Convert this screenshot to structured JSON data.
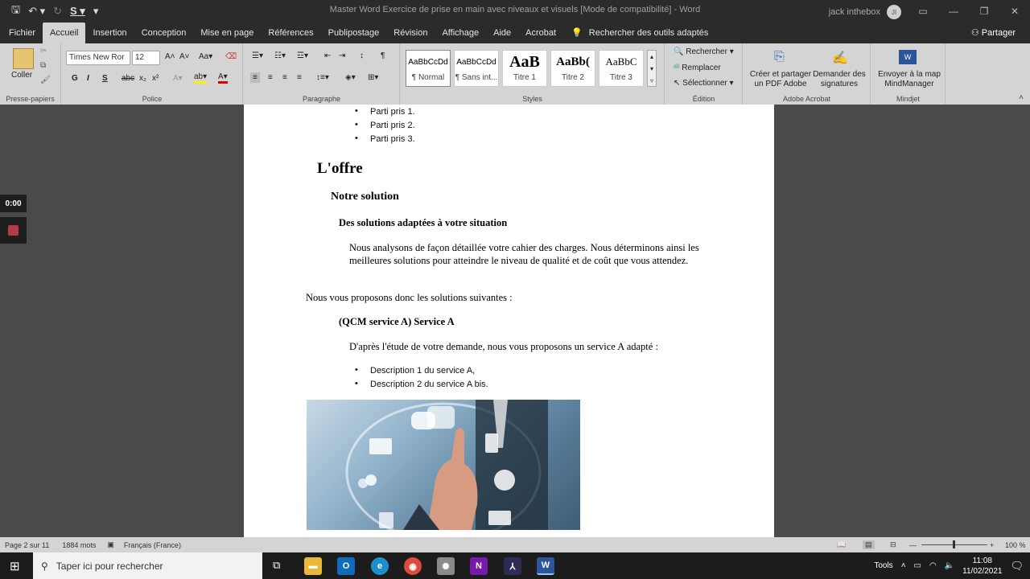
{
  "window": {
    "title": "Master Word Exercice de prise en main avec niveaux et visuels [Mode de compatibilité]  -  Word",
    "user_name": "jack inthebox",
    "user_initials": "JI"
  },
  "tabs": [
    "Fichier",
    "Accueil",
    "Insertion",
    "Conception",
    "Mise en page",
    "Références",
    "Publipostage",
    "Révision",
    "Affichage",
    "Aide",
    "Acrobat"
  ],
  "active_tab": "Accueil",
  "tell_me": "Rechercher des outils adaptés",
  "share_label": "Partager",
  "ribbon": {
    "clipboard": {
      "paste_label": "Coller",
      "group_label": "Presse-papiers"
    },
    "font": {
      "font_name": "Times New Ror",
      "font_size": "12",
      "group_label": "Police",
      "bold": "G",
      "italic": "I",
      "underline": "S"
    },
    "paragraph": {
      "group_label": "Paragraphe"
    },
    "styles": {
      "group_label": "Styles",
      "items": [
        {
          "preview": "AaBbCcDd",
          "name": "¶ Normal"
        },
        {
          "preview": "AaBbCcDd",
          "name": "¶ Sans int..."
        },
        {
          "preview": "AaB",
          "name": "Titre 1"
        },
        {
          "preview": "AaBb(",
          "name": "Titre 2"
        },
        {
          "preview": "AaBbC",
          "name": "Titre 3"
        }
      ]
    },
    "editing": {
      "group_label": "Édition",
      "find": "Rechercher",
      "replace": "Remplacer",
      "select": "Sélectionner"
    },
    "acrobat": {
      "group_label": "Adobe Acrobat",
      "create_pdf": "Créer et partager un PDF Adobe",
      "request_sign": "Demander des signatures"
    },
    "mindjet": {
      "group_label": "Mindjet",
      "send": "Envoyer à la map MindManager"
    }
  },
  "document": {
    "bullets_top": [
      "Parti pris 1.",
      "Parti pris 2.",
      "Parti pris 3."
    ],
    "heading1": "L'offre",
    "heading2": "Notre solution",
    "heading3": "Des solutions adaptées à votre situation",
    "para1": "Nous analysons de façon détaillée votre cahier des charges. Nous déterminons ainsi les meilleures solutions pour atteindre le niveau de qualité et de coût que vous attendez.",
    "para2": "Nous vous proposons donc les solutions suivantes :",
    "heading3b": "(QCM service A) Service A",
    "para3": "D'après l'étude de votre demande, nous vous proposons un service A adapté :",
    "bullets_bottom": [
      "Description 1 du service A,",
      "Description 2 du service A bis."
    ]
  },
  "recorder": {
    "time": "0:00"
  },
  "status_bar": {
    "page": "Page 2 sur 11",
    "words": "1884 mots",
    "language": "Français (France)",
    "zoom": "100 %"
  },
  "taskbar": {
    "search_placeholder": "Taper ici pour rechercher",
    "tools_label": "Tools",
    "time": "11:08",
    "date": "11/02/2021"
  },
  "colors": {
    "accent_word": "#2b579a",
    "ribbon_bg": "#d4d4d4",
    "dark_bg": "#2b2b2b"
  }
}
